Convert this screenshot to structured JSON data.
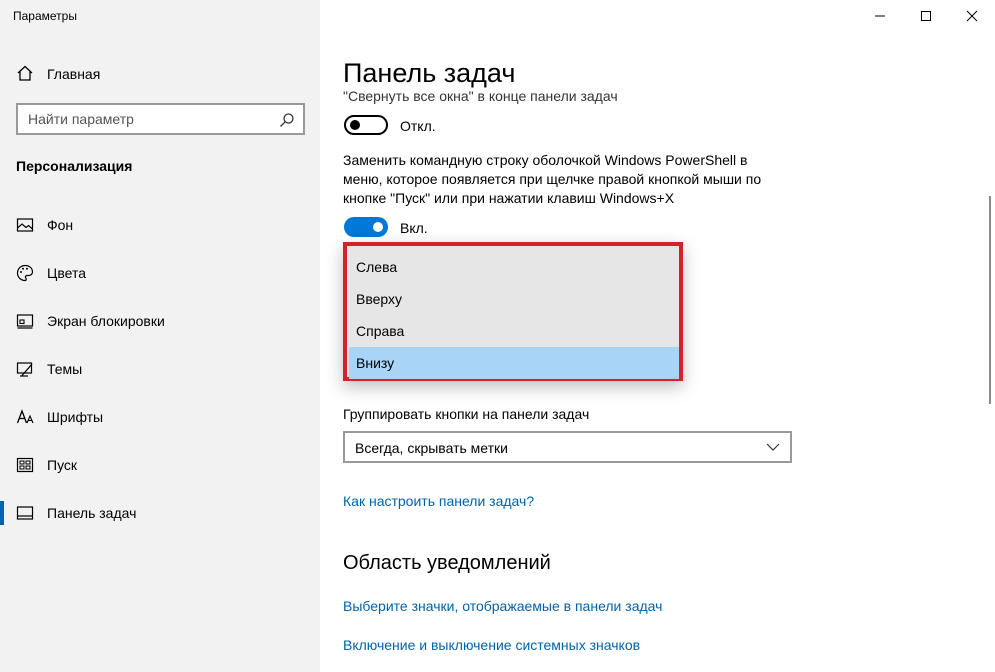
{
  "window": {
    "title": "Параметры",
    "controls": [
      "minimize-icon",
      "maximize-icon",
      "close-icon"
    ]
  },
  "sidebar": {
    "home": {
      "label": "Главная",
      "icon": "home-icon"
    },
    "search": {
      "placeholder": "Найти параметр",
      "icon": "search-icon"
    },
    "section": "Персонализация",
    "items": [
      {
        "label": "Фон",
        "icon": "picture-icon"
      },
      {
        "label": "Цвета",
        "icon": "palette-icon"
      },
      {
        "label": "Экран блокировки",
        "icon": "lock-screen-icon"
      },
      {
        "label": "Темы",
        "icon": "themes-icon"
      },
      {
        "label": "Шрифты",
        "icon": "fonts-icon"
      },
      {
        "label": "Пуск",
        "icon": "start-icon"
      },
      {
        "label": "Панель задач",
        "icon": "taskbar-icon",
        "active": true
      }
    ]
  },
  "main": {
    "title": "Панель задач",
    "clipped_text": "\"Свернуть все окна\" в конце панели задач",
    "toggle1": {
      "state_label": "Откл.",
      "on": false
    },
    "powershell_desc": "Заменить командную строку оболочкой Windows PowerShell в меню, которое появляется при щелчке правой кнопкой мыши по кнопке \"Пуск\" или при нажатии клавиш Windows+X",
    "toggle2": {
      "state_label": "Вкл.",
      "on": true
    },
    "position_options": [
      "Слева",
      "Вверху",
      "Справа",
      "Внизу"
    ],
    "position_selected": "Внизу",
    "group_label": "Группировать кнопки на панели задач",
    "group_value": "Всегда, скрывать метки",
    "help_link": "Как настроить панели задач?",
    "notifications_heading": "Область уведомлений",
    "notif_link1": "Выберите значки, отображаемые в панели задач",
    "notif_link2": "Включение и выключение системных значков"
  },
  "colors": {
    "accent": "#0078d7",
    "link": "#0063b1",
    "highlight_border": "#d8202a",
    "selected_option": "#a8d4f7"
  }
}
